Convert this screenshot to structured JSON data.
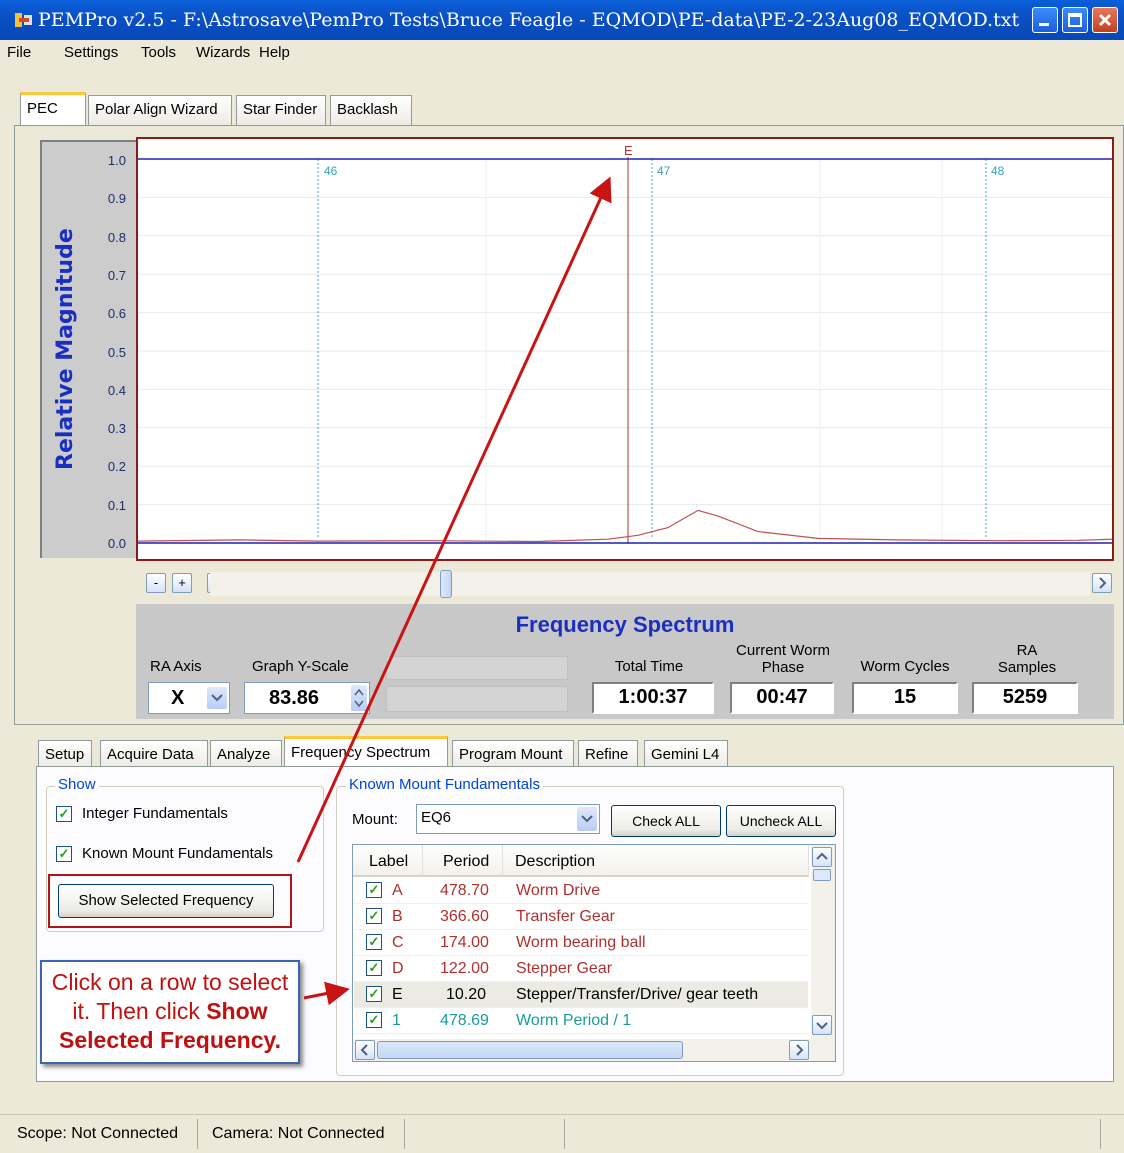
{
  "window": {
    "title": "PEMPro v2.5 - F:\\Astrosave\\PemPro Tests\\Bruce Feagle - EQMOD\\PE-data\\PE-2-23Aug08_EQMOD.txt"
  },
  "menu": [
    "File",
    "Settings",
    "Tools",
    "Wizards",
    "Help"
  ],
  "top_tabs": [
    "PEC",
    "Polar Align Wizard",
    "Star Finder",
    "Backlash"
  ],
  "top_tabs_active": "PEC",
  "graph": {
    "ylabel": "Relative Magnitude",
    "yticks": [
      "1.0",
      "0.9",
      "0.8",
      "0.7",
      "0.6",
      "0.5",
      "0.4",
      "0.3",
      "0.2",
      "0.1",
      "0.0"
    ],
    "marker_labels": [
      "46",
      "47",
      "48"
    ],
    "selected_marker": "E",
    "zoom_out": "-",
    "zoom_in": "+"
  },
  "chart_data": {
    "type": "line",
    "ylabel": "Relative Magnitude",
    "ylim": [
      0,
      1.0
    ],
    "series": [
      {
        "x": [
          0,
          100,
          180,
          290,
          400,
          470,
          500,
          530,
          560,
          580,
          620,
          680,
          760,
          860,
          940,
          975
        ],
        "y": [
          0.005,
          0.008,
          0.005,
          0.006,
          0.004,
          0.01,
          0.02,
          0.04,
          0.085,
          0.07,
          0.03,
          0.012,
          0.008,
          0.006,
          0.007,
          0.01
        ]
      }
    ]
  },
  "info": {
    "title": "Frequency Spectrum",
    "ra_axis_label": "RA Axis",
    "ra_axis_value": "X",
    "yscale_label": "Graph Y-Scale",
    "yscale_value": "83.86",
    "total_time_label": "Total Time",
    "total_time_value": "1:00:37",
    "worm_phase_label_1": "Current Worm",
    "worm_phase_label_2": "Phase",
    "worm_phase_value": "00:47",
    "worm_cycles_label": "Worm Cycles",
    "worm_cycles_value": "15",
    "ra_samples_label_1": "RA",
    "ra_samples_label_2": "Samples",
    "ra_samples_value": "5259"
  },
  "bottom_tabs": [
    "Setup",
    "Acquire Data",
    "Analyze",
    "Frequency Spectrum",
    "Program Mount",
    "Refine",
    "Gemini L4"
  ],
  "bottom_tabs_active": "Frequency Spectrum",
  "show": {
    "legend": "Show",
    "integer_fundamentals": "Integer Fundamentals",
    "known_mount_fundamentals": "Known Mount Fundamentals",
    "show_selected_button": "Show Selected Frequency"
  },
  "known": {
    "legend": "Known Mount Fundamentals",
    "mount_label": "Mount:",
    "mount_value": "EQ6",
    "check_all": "Check ALL",
    "uncheck_all": "Uncheck ALL",
    "columns": [
      "Label",
      "Period",
      "Description"
    ],
    "rows": [
      {
        "label": "A",
        "period": "478.70",
        "desc": "Worm Drive"
      },
      {
        "label": "B",
        "period": "366.60",
        "desc": "Transfer Gear"
      },
      {
        "label": "C",
        "period": "174.00",
        "desc": "Worm bearing ball"
      },
      {
        "label": "D",
        "period": "122.00",
        "desc": "Stepper Gear"
      },
      {
        "label": "E",
        "period": "10.20",
        "desc": "Stepper/Transfer/Drive/ gear teeth"
      },
      {
        "label": "1",
        "period": "478.69",
        "desc": "Worm Period / 1"
      }
    ]
  },
  "callout": {
    "line1": "Click on a row to select",
    "line2a": "it. Then click ",
    "line2b": "Show",
    "line3": "Selected Frequency."
  },
  "status": {
    "scope": "Scope: Not Connected",
    "camera": "Camera: Not Connected"
  },
  "colors": {
    "accent_blue": "#1a2fc0",
    "plot_border": "#8b1a1a",
    "arrow": "#c81414",
    "known_row_text": "#b03030",
    "integer_row_text": "#1a9c9c"
  }
}
